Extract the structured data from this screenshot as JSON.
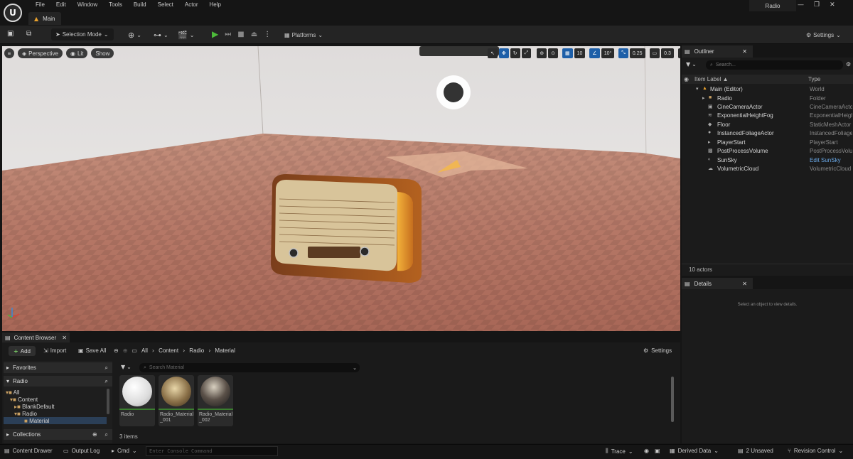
{
  "menu": [
    "File",
    "Edit",
    "Window",
    "Tools",
    "Build",
    "Select",
    "Actor",
    "Help"
  ],
  "window": {
    "tab": "Main",
    "project": "Radio",
    "controls": [
      "—",
      "❐",
      "✕"
    ]
  },
  "toolbar": {
    "selection_mode": "Selection Mode",
    "platforms": "Platforms",
    "settings": "Settings"
  },
  "viewport": {
    "perspective": "Perspective",
    "lit": "Lit",
    "show": "Show",
    "grid_snap": "10",
    "rot_snap": "10°",
    "scale_snap": "0.25",
    "camera_speed": "0.3"
  },
  "outliner": {
    "title": "Outliner",
    "search_placeholder": "Search...",
    "col_label": "Item Label ▲",
    "col_type": "Type",
    "rows": [
      {
        "label": "Main (Editor)",
        "type": "World"
      },
      {
        "label": "Radio",
        "type": "Folder"
      },
      {
        "label": "CineCameraActor",
        "type": "CineCameraActor"
      },
      {
        "label": "ExponentialHeightFog",
        "type": "ExponentialHeightFog"
      },
      {
        "label": "Floor",
        "type": "StaticMeshActor"
      },
      {
        "label": "InstancedFoliageActor",
        "type": "InstancedFoliageActor"
      },
      {
        "label": "PlayerStart",
        "type": "PlayerStart"
      },
      {
        "label": "PostProcessVolume",
        "type": "PostProcessVolume"
      },
      {
        "label": "SunSky",
        "type": "Edit SunSky"
      },
      {
        "label": "VolumetricCloud",
        "type": "VolumetricCloud"
      }
    ],
    "count": "10 actors"
  },
  "details": {
    "title": "Details",
    "empty": "Select an object to view details."
  },
  "content_browser": {
    "title": "Content Browser",
    "add": "Add",
    "import": "Import",
    "save_all": "Save All",
    "breadcrumb": [
      "All",
      "Content",
      "Radio",
      "Material"
    ],
    "settings": "Settings",
    "favorites": "Favorites",
    "project": "Radio",
    "tree": [
      "All",
      "Content",
      "BlankDefault",
      "Radio",
      "Material"
    ],
    "collections": "Collections",
    "search_placeholder": "Search Material",
    "assets": [
      {
        "name": "Radio"
      },
      {
        "name": "Radio_Material_001"
      },
      {
        "name": "Radio_Material_002"
      }
    ],
    "item_count": "3 items"
  },
  "statusbar": {
    "content_drawer": "Content Drawer",
    "output_log": "Output Log",
    "cmd": "Cmd",
    "console_placeholder": "Enter Console Command",
    "trace": "Trace",
    "derived_data": "Derived Data",
    "unsaved": "2 Unsaved",
    "revision_control": "Revision Control"
  }
}
